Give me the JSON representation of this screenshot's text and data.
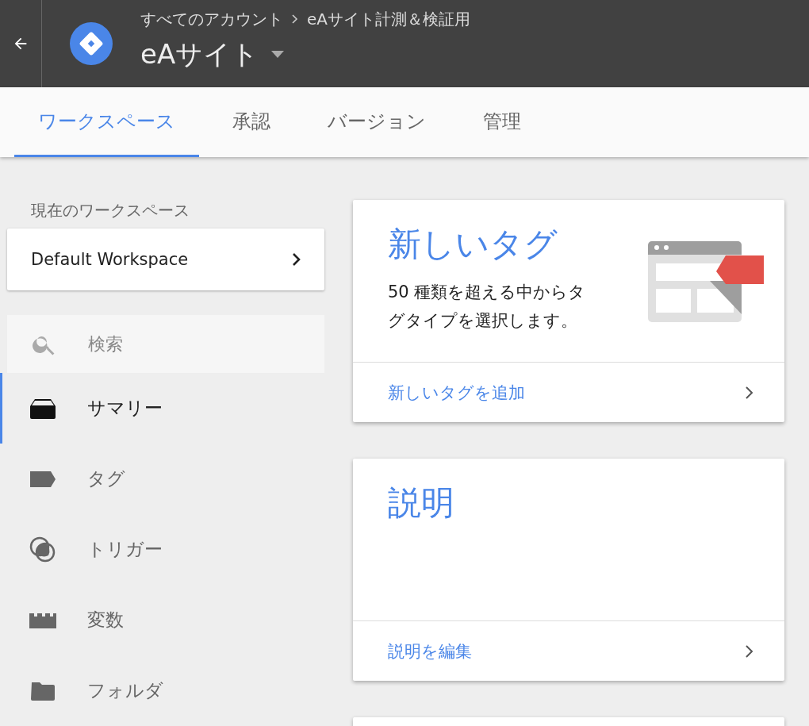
{
  "header": {
    "breadcrumb": [
      "すべてのアカウント",
      "eAサイト計測＆検証用"
    ],
    "container_name": "eAサイト"
  },
  "tabs": [
    {
      "label": "ワークスペース",
      "selected": true
    },
    {
      "label": "承認",
      "selected": false
    },
    {
      "label": "バージョン",
      "selected": false
    },
    {
      "label": "管理",
      "selected": false
    }
  ],
  "sidebar": {
    "workspace_label": "現在のワークスペース",
    "workspace_name": "Default Workspace",
    "search": {
      "placeholder": "検索"
    },
    "items": [
      {
        "label": "サマリー",
        "kind": "summary",
        "selected": true
      },
      {
        "label": "タグ",
        "kind": "tag",
        "selected": false
      },
      {
        "label": "トリガー",
        "kind": "trigger",
        "selected": false
      },
      {
        "label": "変数",
        "kind": "variable",
        "selected": false
      },
      {
        "label": "フォルダ",
        "kind": "folder",
        "selected": false
      }
    ]
  },
  "cards": [
    {
      "title": "新しいタグ",
      "body": "50 種類を超える中からタグタイプを選択します。",
      "link": "新しいタグを追加",
      "illustration": true
    },
    {
      "title": "説明",
      "link": "説明を編集",
      "illustration": false
    }
  ]
}
